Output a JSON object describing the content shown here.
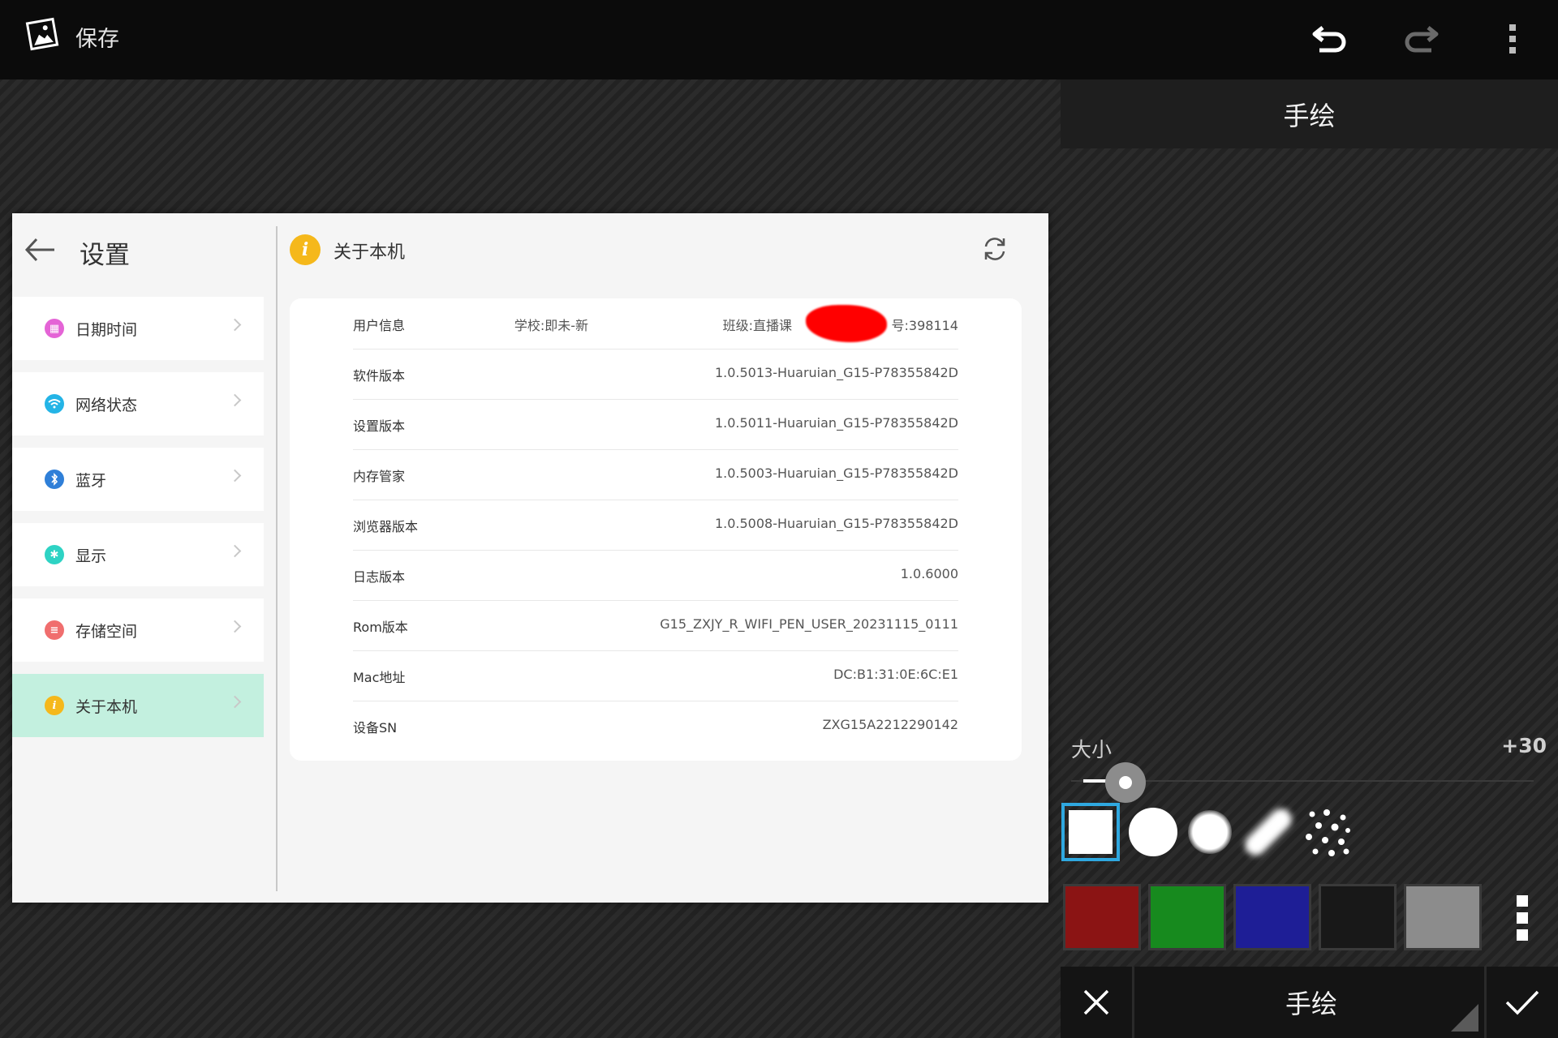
{
  "topbar": {
    "title": "保存",
    "icons": [
      "photo-icon",
      "undo-icon",
      "redo-icon",
      "more-vert-icon"
    ]
  },
  "right_panel": {
    "header": "手绘",
    "size_label": "大小",
    "size_value": "+30",
    "size_level": 0.1,
    "brushes": [
      "square-brush",
      "circle-brush",
      "soft-brush",
      "blur-brush",
      "spray-brush"
    ],
    "selected_brush": 0,
    "colors": [
      "#8b1414",
      "#178a1e",
      "#1e1e96",
      "#181818",
      "#8c8c8c"
    ],
    "bottom": {
      "mode": "手绘"
    }
  },
  "settings": {
    "title": "设置",
    "nav": [
      {
        "label": "日期时间",
        "color": "#e464d6",
        "icon": "calendar-icon"
      },
      {
        "label": "网络状态",
        "color": "#24b4e6",
        "icon": "wifi-icon"
      },
      {
        "label": "蓝牙",
        "color": "#2f7fd8",
        "icon": "bluetooth-icon"
      },
      {
        "label": "显示",
        "color": "#2ed3c4",
        "icon": "display-icon"
      },
      {
        "label": "存储空间",
        "color": "#f06e6e",
        "icon": "storage-icon"
      },
      {
        "label": "关于本机",
        "color": "#f5b81b",
        "icon": "info-icon"
      }
    ],
    "active_index": 5,
    "about": {
      "title": "关于本机",
      "rows": [
        {
          "key": "用户信息",
          "school": "学校:即未-新",
          "class": "班级:直播课",
          "account_tail": "号:398114"
        },
        {
          "key": "软件版本",
          "value": "1.0.5013-Huaruian_G15-P78355842D"
        },
        {
          "key": "设置版本",
          "value": "1.0.5011-Huaruian_G15-P78355842D"
        },
        {
          "key": "内存管家",
          "value": "1.0.5003-Huaruian_G15-P78355842D"
        },
        {
          "key": "浏览器版本",
          "value": "1.0.5008-Huaruian_G15-P78355842D"
        },
        {
          "key": "日志版本",
          "value": "1.0.6000"
        },
        {
          "key": "Rom版本",
          "value": "G15_ZXJY_R_WIFI_PEN_USER_20231115_0111"
        },
        {
          "key": "Mac地址",
          "value": "DC:B1:31:0E:6C:E1"
        },
        {
          "key": "设备SN",
          "value": "ZXG15A2212290142"
        }
      ]
    }
  }
}
